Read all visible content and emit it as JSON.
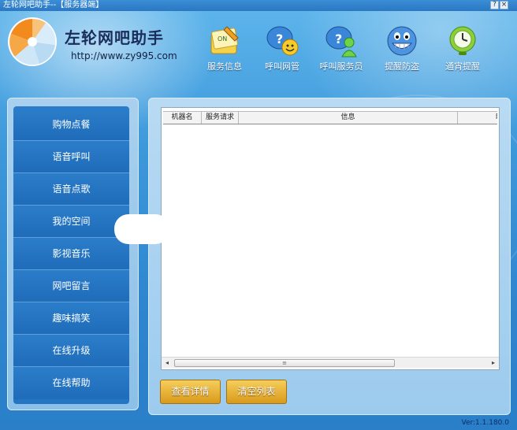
{
  "window": {
    "title": "左轮网吧助手--【服务器端】",
    "controls": [
      "?",
      "×"
    ]
  },
  "branding": {
    "name": "左轮网吧助手",
    "url": "http://www.zy995.com"
  },
  "top_nav": [
    {
      "label": "服务信息",
      "icon": "notes-pencil-icon"
    },
    {
      "label": "呼叫网管",
      "icon": "smiley-bubble-icon"
    },
    {
      "label": "呼叫服务员",
      "icon": "person-bubble-icon"
    },
    {
      "label": "提醒防盗",
      "icon": "grin-face-icon"
    },
    {
      "label": "通宵提醒",
      "icon": "clock-icon"
    }
  ],
  "sidebar": {
    "items": [
      {
        "label": "购物点餐"
      },
      {
        "label": "语音呼叫"
      },
      {
        "label": "语音点歌"
      },
      {
        "label": "我的空间"
      },
      {
        "label": "影视音乐"
      },
      {
        "label": "网吧留言"
      },
      {
        "label": "趣味搞笑"
      },
      {
        "label": "在线升级"
      },
      {
        "label": "在线帮助"
      }
    ]
  },
  "table": {
    "columns": [
      "机器名",
      "服务请求",
      "信息",
      "时"
    ],
    "rows": [],
    "scroll_thumb_label": "≡"
  },
  "actions": {
    "details_label": "查看详情",
    "clear_label": "清空列表"
  },
  "version": "Ver:1.1.180.0",
  "colors": {
    "background": "#3d98da",
    "menu": "#2476c4",
    "button": "#e0a62a"
  }
}
